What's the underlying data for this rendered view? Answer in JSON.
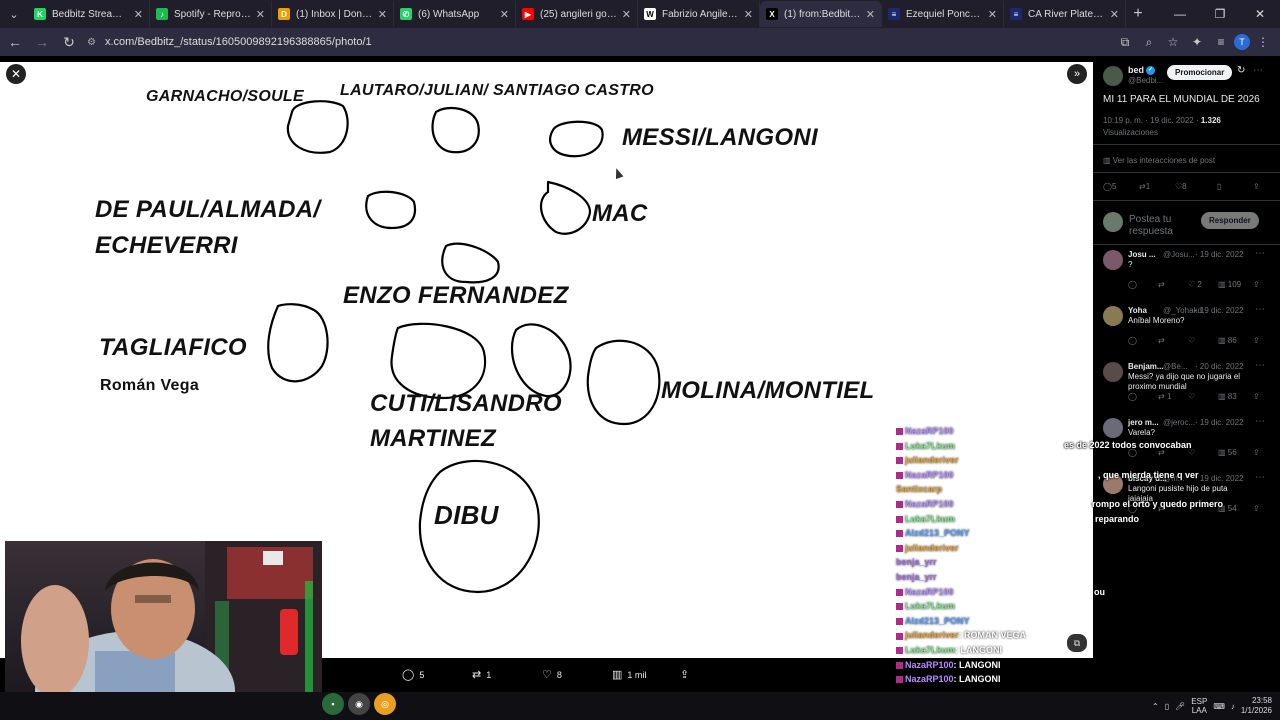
{
  "browser": {
    "tabs": [
      {
        "title": "Bedbitz Stream - Wa",
        "color": "#1fd65f",
        "glyph": "K"
      },
      {
        "title": "Spotify - Reproductor",
        "color": "#1db954",
        "glyph": "♪"
      },
      {
        "title": "(1) Inbox | Donoclip",
        "color": "#e8a100",
        "glyph": "D"
      },
      {
        "title": "(6) WhatsApp",
        "color": "#25d366",
        "glyph": "✆"
      },
      {
        "title": "(25) angileri gol defe",
        "color": "#ff0000",
        "glyph": "▶"
      },
      {
        "title": "Fabrizio Angileri - Wi",
        "color": "#ffffff",
        "glyph": "W"
      },
      {
        "title": "(1) from:Bedbitz_202",
        "color": "#000000",
        "glyph": "X",
        "active": true
      },
      {
        "title": "Ezequiel Ponce - Data",
        "color": "#1a2a6c",
        "glyph": "≡"
      },
      {
        "title": "CA River Plate - Plan",
        "color": "#1a2a6c",
        "glyph": "≡"
      }
    ],
    "url": "x.com/Bedbitz_/status/1605009892196388865/photo/1",
    "profile_initial": "T"
  },
  "drawing": {
    "labels": [
      {
        "key": "garnacho",
        "text": "GARNACHO/SOULE"
      },
      {
        "key": "lautaro",
        "text": "LAUTARO/JULIAN/ SANTIAGO CASTRO"
      },
      {
        "key": "messi",
        "text": "MESSI/LANGONI"
      },
      {
        "key": "depaul1",
        "text": "DE PAUL/ALMADA/"
      },
      {
        "key": "depaul2",
        "text": "ECHEVERRI"
      },
      {
        "key": "mac",
        "text": "MAC"
      },
      {
        "key": "enzo",
        "text": "ENZO FERNANDEZ"
      },
      {
        "key": "tagliafico",
        "text": "TAGLIAFICO"
      },
      {
        "key": "roman",
        "text": "Román Vega"
      },
      {
        "key": "molina",
        "text": "MOLINA/MONTIEL"
      },
      {
        "key": "cuti1",
        "text": "CUTI/LISANDRO"
      },
      {
        "key": "cuti2",
        "text": "MARTINEZ"
      },
      {
        "key": "dibu",
        "text": "DIBU"
      }
    ]
  },
  "photo_actions": {
    "replies": "5",
    "reposts": "1",
    "likes": "8",
    "views": "1 mil"
  },
  "post": {
    "author_name": "bed",
    "author_handle": "@Bedbi...",
    "promote_label": "Promocionar",
    "text": "MI 11 PARA EL MUNDIAL DE 2026",
    "time": "10:19 p. m. · 19 dic. 2022 ·",
    "views_count": "1.326",
    "views_label": "Visualizaciones",
    "interactions_label": "Ver las interacciones de post",
    "stats": {
      "replies": "5",
      "reposts": "1",
      "likes": "8"
    },
    "reply_placeholder": "Postea tu respuesta",
    "reply_button": "Responder"
  },
  "replies": [
    {
      "name": "Josu ...",
      "handle": "@Josu...",
      "date": "· 19 dic. 2022",
      "text": "?",
      "likes": "2",
      "views": "109",
      "avatar": "#7a5a6a"
    },
    {
      "name": "Yoha",
      "handle": "@_Yohakd",
      "date": "· 19 dic. 2022",
      "text": "Aníbal Moreno?",
      "likes": "",
      "views": "86",
      "avatar": "#8a7a50"
    },
    {
      "name": "Benjam...",
      "handle": "@Be...",
      "date": "· 20 dic. 2022",
      "text": "Messi? ya dijo que no jugaria el proximo mundial",
      "likes": "",
      "views": "83",
      "avatar": "#5a4a4a",
      "reposts": "1"
    },
    {
      "name": "jero m...",
      "handle": "@jeroc...",
      "date": "· 19 dic. 2022",
      "text": "Varela?",
      "likes": "",
      "views": "56",
      "avatar": "#6a6a7a"
    },
    {
      "name": "biscay d...",
      "handle": "@m...",
      "date": "· 19 dic. 2022",
      "text": "Langoni pusiste hijo de puta jajajaja",
      "likes": "",
      "views": "54",
      "avatar": "#9a7a6a"
    }
  ],
  "chat": [
    {
      "user": "NazaRP100",
      "color": "#b48cff",
      "text": "",
      "badge": true
    },
    {
      "user": "Luka7Lkum",
      "color": "#7be38a",
      "text": "",
      "badge": true
    },
    {
      "user": "julianderiver",
      "color": "#e0a030",
      "text": "",
      "badge": true
    },
    {
      "user": "NazaRP100",
      "color": "#b48cff",
      "text": "",
      "badge": true
    },
    {
      "user": "Santixcarp",
      "color": "#e0a030",
      "text": "",
      "badge": false
    },
    {
      "user": "NazaRP100",
      "color": "#b48cff",
      "text": "",
      "badge": true
    },
    {
      "user": "Luka7Lkum",
      "color": "#7be38a",
      "text": "",
      "badge": true
    },
    {
      "user": "Alzd213_PONY",
      "color": "#5aa0ff",
      "text": "",
      "badge": true
    },
    {
      "user": "julianderiver",
      "color": "#e0a030",
      "text": "",
      "badge": true
    },
    {
      "user": "benja_yrr",
      "color": "#a070e0",
      "text": "",
      "badge": false
    },
    {
      "user": "benja_yrr",
      "color": "#a070e0",
      "text": "",
      "badge": false
    },
    {
      "user": "NazaRP100",
      "color": "#b48cff",
      "text": "",
      "badge": true
    },
    {
      "user": "Luka7Lkum",
      "color": "#7be38a",
      "text": "",
      "badge": true
    },
    {
      "user": "Alzd213_PONY",
      "color": "#5aa0ff",
      "text": "",
      "badge": true
    },
    {
      "user": "julianderiver",
      "color": "#e0a030",
      "text": ": ROMAN VEGA",
      "badge": true
    },
    {
      "user": "Luka7Lkum",
      "color": "#7be38a",
      "text": ": LANGONI",
      "badge": true
    },
    {
      "user": "NazaRP100",
      "color": "#b48cff",
      "text": ": LANGONI",
      "badge": true
    },
    {
      "user": "NazaRP100",
      "color": "#b48cff",
      "text": ": LANGONI",
      "badge": true
    }
  ],
  "chat_overlay_lines": [
    "es de 2022 todos convocaban",
    ", que mierda tiene q ver",
    "rompo el orto y quedo primero",
    "reparando",
    "ou"
  ],
  "system": {
    "lang_top": "ESP",
    "lang_bottom": "LAA",
    "time": "23:58",
    "date": "1/1/2026"
  }
}
